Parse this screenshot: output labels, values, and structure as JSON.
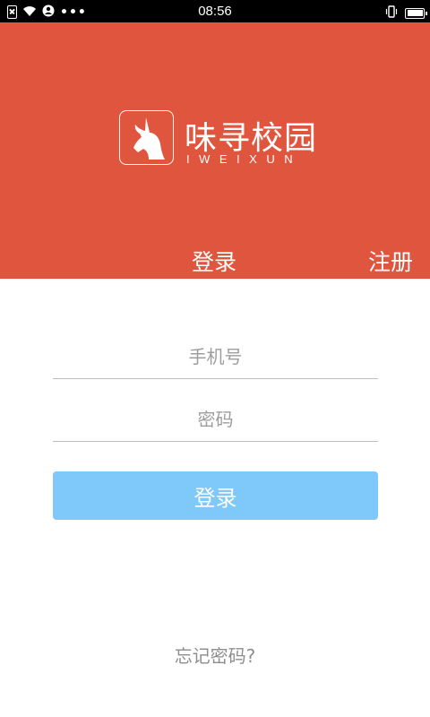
{
  "status_bar": {
    "time": "08:56",
    "icons": [
      "sim-blocked-icon",
      "wifi-icon",
      "user-icon",
      "more-dots-icon",
      "vibrate-icon",
      "battery-icon"
    ],
    "more_dots": "•••",
    "battery_level": 1.0
  },
  "header": {
    "background_color": "#e0553e",
    "logo_icon": "unicorn-icon",
    "app_title": "味寻校园",
    "app_subtitle": "IWEIXUN",
    "tabs": {
      "login": "登录",
      "register": "注册"
    }
  },
  "form": {
    "phone_placeholder": "手机号",
    "password_placeholder": "密码",
    "login_button": "登录",
    "login_button_color": "#7ec8fa",
    "forgot_password": "忘记密码?"
  }
}
